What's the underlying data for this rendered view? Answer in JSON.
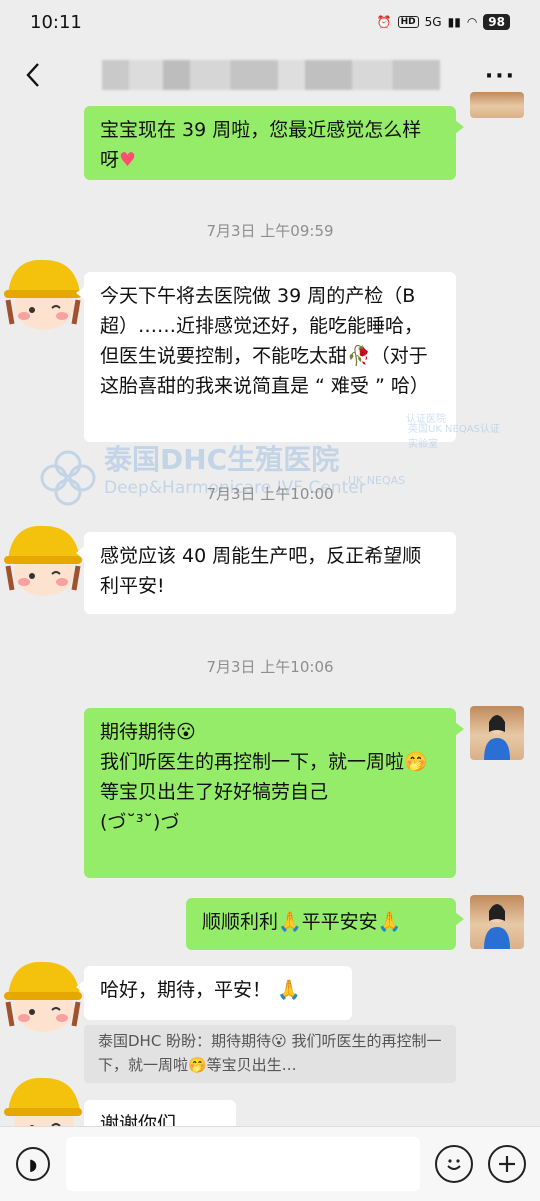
{
  "status": {
    "time": "10:11",
    "hd": "HD",
    "signal": "5G",
    "battery": "98"
  },
  "nav": {
    "more": "···"
  },
  "messages": {
    "m1": {
      "text": "宝宝现在 39 周啦，您最近感觉怎么样呀",
      "emoji": "♥"
    },
    "t1": "7月3日 上午09:59",
    "m2": {
      "text": "今天下午将去医院做 39 周的产检（B 超）……近排感觉还好，能吃能睡哈，但医生说要控制，不能吃太甜",
      "emoji": "🥀",
      "text2": "（对于这胎喜甜的我来说简直是 “ 难受 ” 哈）"
    },
    "t2": "7月3日 上午10:00",
    "m3": {
      "text": "感觉应该 40 周能生产吧，反正希望顺利平安!"
    },
    "t3": "7月3日 上午10:06",
    "m4": {
      "line1": "期待期待",
      "line2a": "我们听医生的再控制一下，就一周啦",
      "line2b": "等宝贝出生了好好犒劳自己",
      "line3": "(づ˘³˘)づ"
    },
    "m5": {
      "text": "顺顺利利🙏平平安安🙏"
    },
    "m6": {
      "text": "哈好，期待，平安！ 🙏"
    },
    "quote": {
      "text": "泰国DHC 盼盼：期待期待😮 我们听医生的再控制一下，就一周啦🤭等宝贝出生…"
    },
    "m7": {
      "text": "谢谢你们"
    }
  },
  "watermark": {
    "cn": "泰国DHC生殖医院",
    "en": "Deep&Harmonicare IVF Center",
    "neqas": "UK NEQAS",
    "badge": "英国UK NEQAS认证实验室",
    "badge2": "认证医院"
  },
  "colors": {
    "green_bubble": "#95ec69",
    "background": "#ededed"
  }
}
